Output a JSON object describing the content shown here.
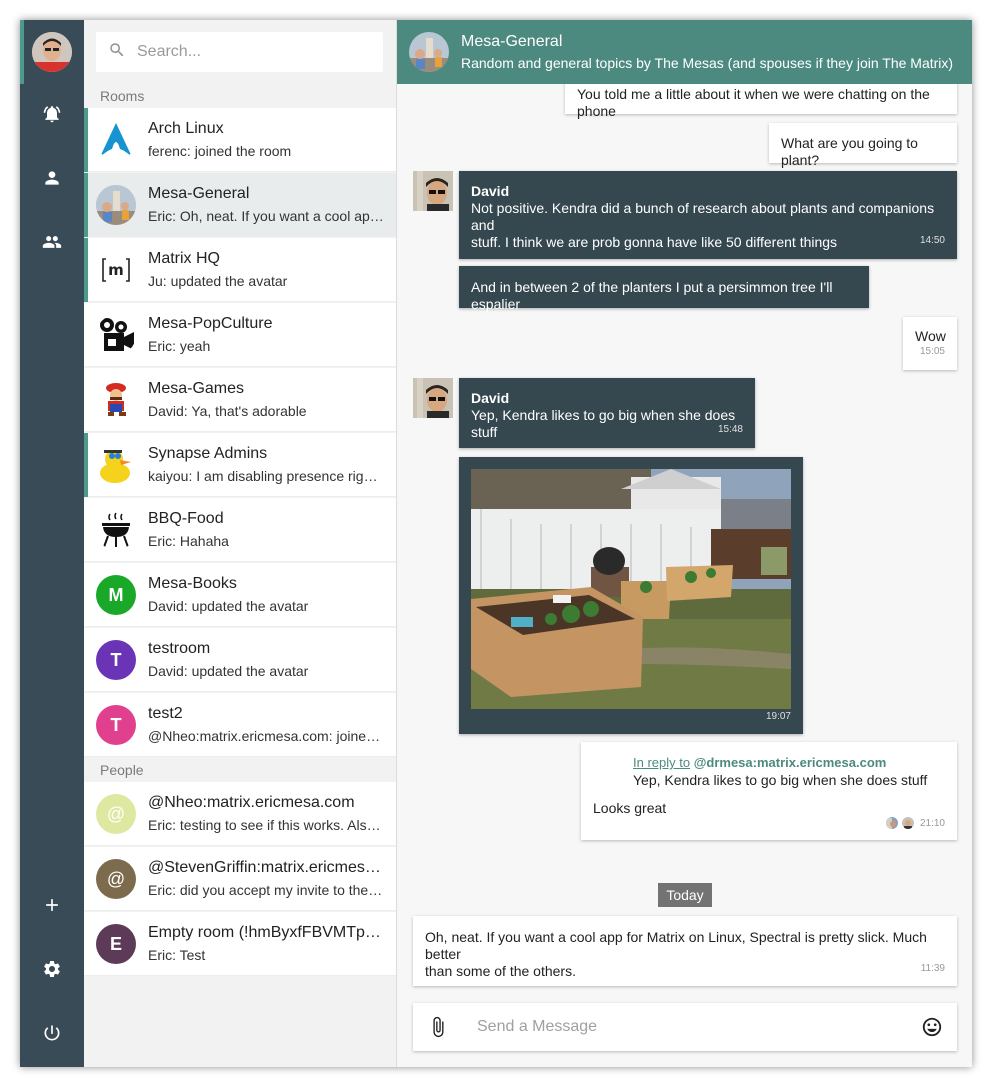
{
  "search": {
    "placeholder": "Search..."
  },
  "sections": {
    "rooms": "Rooms",
    "people": "People"
  },
  "rooms": [
    {
      "name": "Arch Linux",
      "last": "ferenc: joined the room",
      "unread": true
    },
    {
      "name": "Mesa-General",
      "last": "Eric: Oh, neat. If you want a cool app for Matrix on Linux, Spectral is pretty slick. Much better",
      "selected": true,
      "unread": true
    },
    {
      "name": "Matrix HQ",
      "last": "Ju: updated the avatar",
      "unread": true
    },
    {
      "name": "Mesa-PopCulture",
      "last": "Eric: yeah"
    },
    {
      "name": "Mesa-Games",
      "last": "David: Ya, that's adorable"
    },
    {
      "name": "Synapse Admins",
      "last": "kaiyou: I am disabling presence right now",
      "unread": true
    },
    {
      "name": "BBQ-Food",
      "last": "Eric: Hahaha"
    },
    {
      "name": "Mesa-Books",
      "last": "David: updated the avatar",
      "letter": "M",
      "color": "#1aa829"
    },
    {
      "name": "testroom",
      "last": "David: updated the avatar",
      "letter": "T",
      "color": "#6b33b5"
    },
    {
      "name": "test2",
      "last": "@Nheo:matrix.ericmesa.com: joined the room",
      "letter": "T",
      "color": "#e0408e"
    }
  ],
  "people": [
    {
      "name": "@Nheo:matrix.ericmesa.com",
      "last": "Eric: testing to see if this works. Also checking",
      "letter": "@",
      "color": "#dfe8a0"
    },
    {
      "name": "@StevenGriffin:matrix.ericmesa.com",
      "last": "Eric: did you accept my invite to the room?",
      "letter": "@",
      "color": "#7d6b4e"
    },
    {
      "name": "Empty room (!hmByxfFBVMTpfXyz)",
      "last": "Eric: Test",
      "letter": "E",
      "color": "#5d3b58"
    }
  ],
  "header": {
    "title": "Mesa-General",
    "topic": "Random and general topics by The Mesas (and spouses if they join The Matrix)"
  },
  "messages": {
    "m1": "You told me a little about it when we were chatting on the phone",
    "m2": "What are you going to plant?",
    "m3_sender": "David",
    "m3_line1": "Not positive. Kendra did a bunch of research about plants and companions and",
    "m3_line2": "stuff. I think we are prob gonna have like 50 different things",
    "m3_time": "14:50",
    "m4": "And in between 2 of the planters I put a persimmon tree I'll espalier",
    "m5": "Wow",
    "m5_time": "15:05",
    "m6_sender": "David",
    "m6": "Yep, Kendra likes to go big when she does stuff",
    "m6_time": "15:48",
    "m7_time": "19:07",
    "reply_prefix": "In reply to",
    "reply_user": "@drmesa:matrix.ericmesa.com",
    "reply_quote": "Yep, Kendra likes to go big when she does stuff",
    "reply_text": "Looks great",
    "reply_time": "21:10",
    "today": "Today",
    "m9_line1": "Oh, neat. If you want a cool app for Matrix on Linux, Spectral is pretty slick. Much better",
    "m9_line2": "than some of the others.",
    "m9_time": "11:39"
  },
  "composer": {
    "placeholder": "Send a Message"
  },
  "icons": {
    "rail": [
      "notifications-icon",
      "person-icon",
      "group-icon",
      "add-icon",
      "settings-icon",
      "power-icon"
    ],
    "composer": [
      "attach-icon",
      "emoji-icon"
    ]
  },
  "colors": {
    "rail": "#394b57",
    "accent": "#4c9a8b",
    "header": "#4c8a80",
    "dark_bubble": "#35474f"
  }
}
